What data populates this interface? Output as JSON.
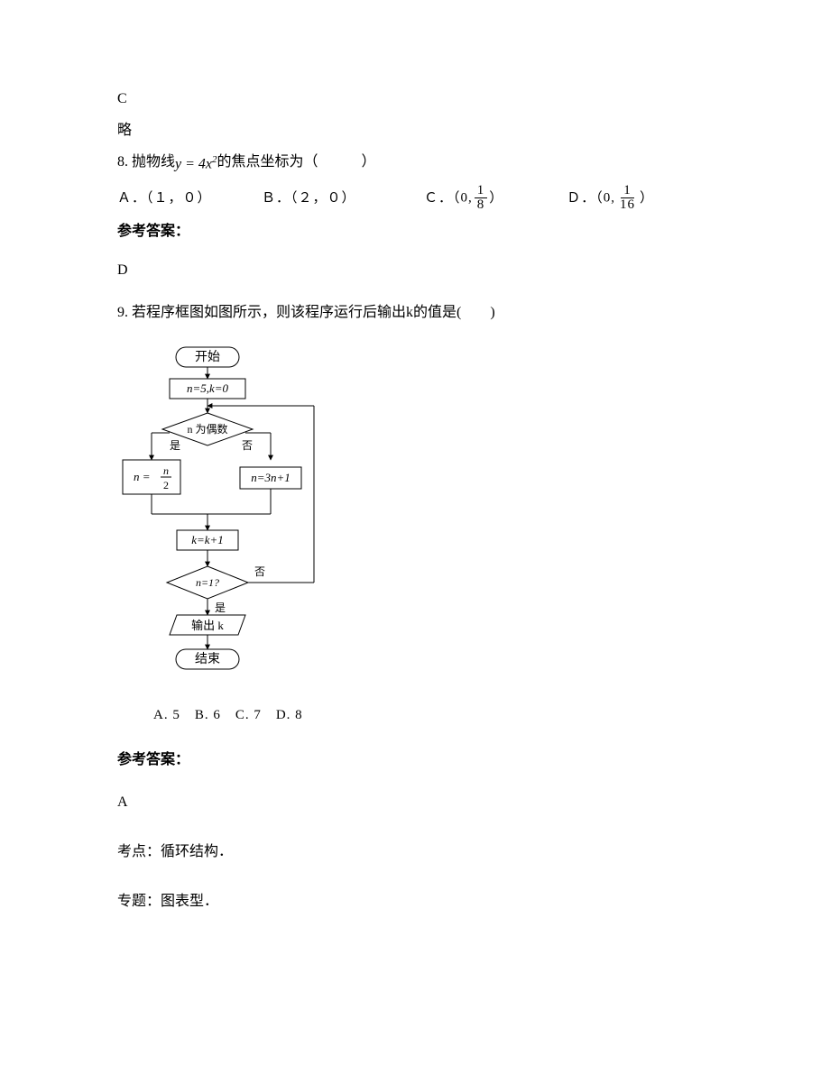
{
  "pre": {
    "answer_c": "C",
    "omit": "略"
  },
  "q8": {
    "prefix": "8. 抛物线",
    "eq_lhs": "y",
    "eq_eq": " = ",
    "eq_coef": "4",
    "eq_var": "x",
    "eq_pow": "2",
    "suffix": " 的焦点坐标为（　　　）",
    "opts": {
      "a": "Ａ．（１，０）",
      "b": "Ｂ．（２，０）",
      "c_prefix": "Ｃ．（",
      "c_zero": "0,",
      "c_num": "1",
      "c_den": "8",
      "c_suffix": "）",
      "d_prefix": "Ｄ．（",
      "d_zero": "0,",
      "d_num": "1",
      "d_den": "16",
      "d_suffix": "）"
    },
    "ref_label": "参考答案：",
    "answer": "D"
  },
  "q9": {
    "stem": "9. 若程序框图如图所示，则该程序运行后输出k的值是(　　)",
    "flow": {
      "start": "开始",
      "init": "n=5,k=0",
      "cond1": "n 为偶数",
      "yes": "是",
      "no": "否",
      "left_num": "n",
      "left_den": "2",
      "left_lhs": "n = ",
      "right": "n=3n+1",
      "kinc": "k=k+1",
      "cond2": "n=1?",
      "out": "输出 k",
      "end": "结束"
    },
    "opts": "A. 5　B. 6　C. 7　D. 8",
    "ref_label": "参考答案：",
    "answer": "A",
    "topic": "考点：循环结构．",
    "special": "专题：图表型．"
  }
}
